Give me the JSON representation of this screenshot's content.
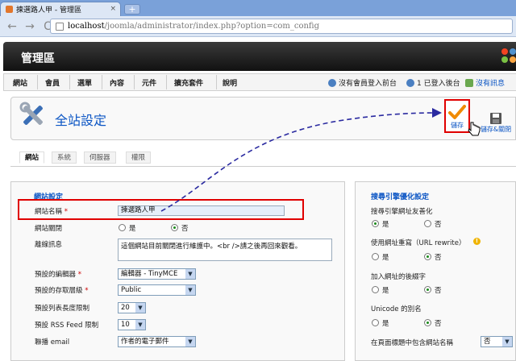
{
  "browser": {
    "tab_title": "揀選路人甲 - 管理區",
    "tab_close": "×",
    "new_tab": "+",
    "back": "←",
    "forward": "→",
    "reload": "C",
    "url_host": "localhost",
    "url_path": "/joomla/administrator/index.php?option=com_config"
  },
  "header": {
    "title": "管理區"
  },
  "menu": {
    "items": [
      "網站",
      "會員",
      "選單",
      "內容",
      "元件",
      "擴充套件",
      "說明"
    ]
  },
  "status": {
    "frontend": "沒有會員登入前台",
    "backend": "1 已登入後台",
    "messages": "沒有訊息"
  },
  "toolbar": {
    "page_title": "全站設定",
    "save_label": "儲存",
    "save_close_label": "儲存&關閉"
  },
  "subtabs": [
    "網站",
    "系統",
    "伺服器",
    "權限"
  ],
  "site_settings": {
    "legend": "網站設定",
    "site_name_label": "網站名稱",
    "site_name_value": "揀選路人甲",
    "site_offline_label": "網站關閉",
    "yes": "是",
    "no": "否",
    "offline_message_label": "離線訊息",
    "offline_message_value": "這個網站目前關閉進行維護中。<br />請之後再回來觀看。",
    "editor_label": "預設的編輯器",
    "editor_value": "編輯器 - TinyMCE",
    "access_label": "預設的存取層級",
    "access_value": "Public",
    "list_limit_label": "預設列表長度限制",
    "list_limit_value": "20",
    "feed_limit_label": "預設 RSS Feed 限制",
    "feed_limit_value": "10",
    "email_label": "聯播 email",
    "email_value": "作者的電子郵件",
    "required_mark": "*"
  },
  "seo_settings": {
    "legend": "搜尋引擎優化設定",
    "sef_label": "搜尋引擎網址友善化",
    "rewrite_label": "使用網址重寫（URL rewrite）",
    "suffix_label": "加入網址的後綴字",
    "unicode_label": "Unicode 的別名",
    "sitename_title_label": "在頁面標題中包含網站名稱",
    "sitename_title_value": "否",
    "yes": "是",
    "no": "否"
  },
  "colors": {
    "accent_blue": "#0b55c4",
    "highlight_red": "#e00000",
    "arrow_blue": "#2a2aa0",
    "check_orange": "#f08a00"
  }
}
